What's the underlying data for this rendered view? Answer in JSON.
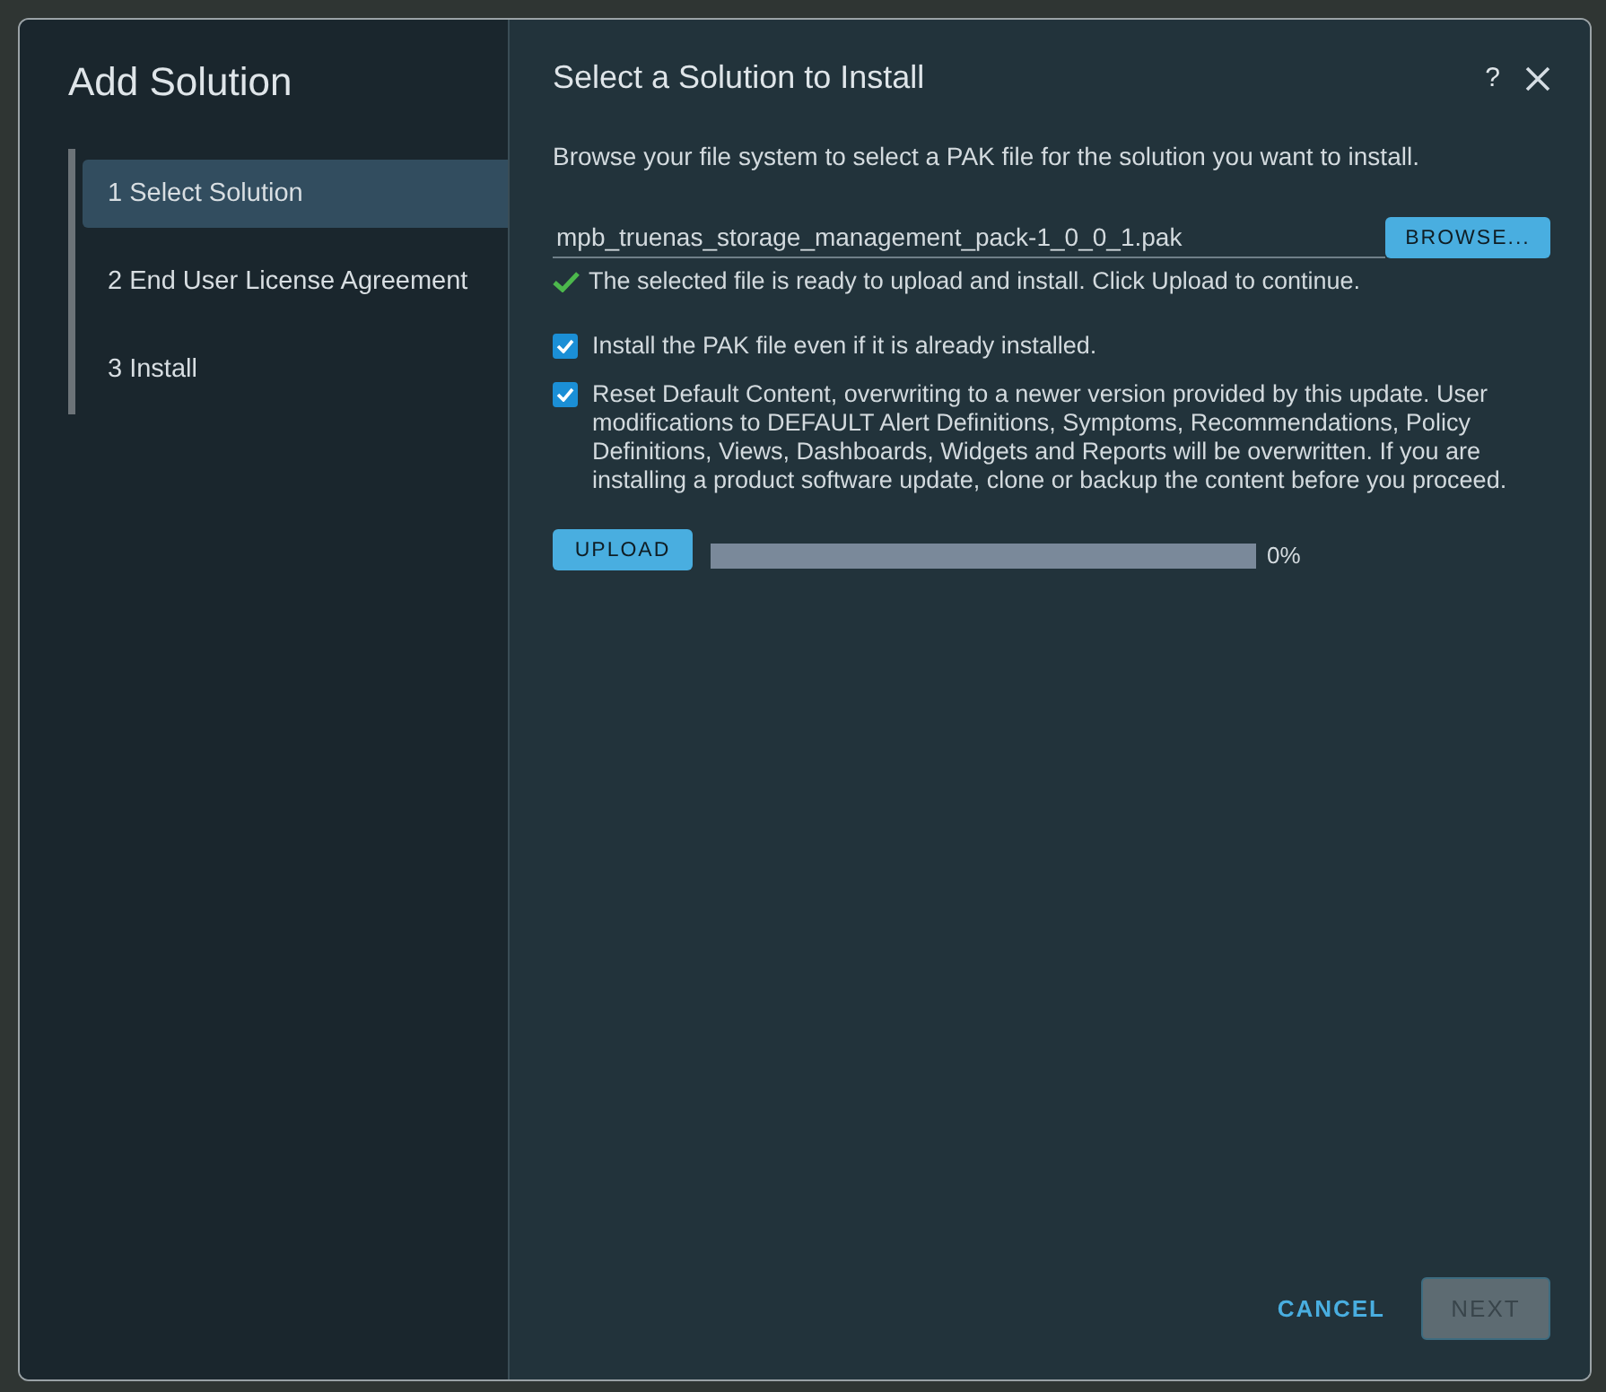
{
  "sidebar": {
    "title": "Add Solution",
    "steps": [
      {
        "label": "1  Select Solution",
        "selected": true
      },
      {
        "label": "2 End User License Agreement",
        "selected": false
      },
      {
        "label": "3 Install",
        "selected": false
      }
    ]
  },
  "header": {
    "title": "Select a Solution to Install",
    "help": "?"
  },
  "intro": "Browse your file system to select a PAK file for the solution you want to install.",
  "file": {
    "value": "mpb_truenas_storage_management_pack-1_0_0_1.pak",
    "browse": "BROWSE...",
    "status": "The selected file is ready to upload and install. Click Upload to continue."
  },
  "options": [
    {
      "label": "Install the PAK file even if it is already installed.",
      "checked": true
    },
    {
      "label": "Reset Default Content, overwriting to a newer version provided by this update. User modifications to DEFAULT Alert Definitions, Symptoms, Recommendations, Policy Definitions, Views, Dashboards, Widgets and Reports will be overwritten. If you are installing a product software update, clone or backup the content before you proceed.",
      "checked": true
    }
  ],
  "upload": {
    "button": "UPLOAD",
    "level": 0,
    "reading": "0%"
  },
  "footer": {
    "cancel": "CANCEL",
    "next": {
      "label": "NEXT",
      "disabled": true
    }
  }
}
